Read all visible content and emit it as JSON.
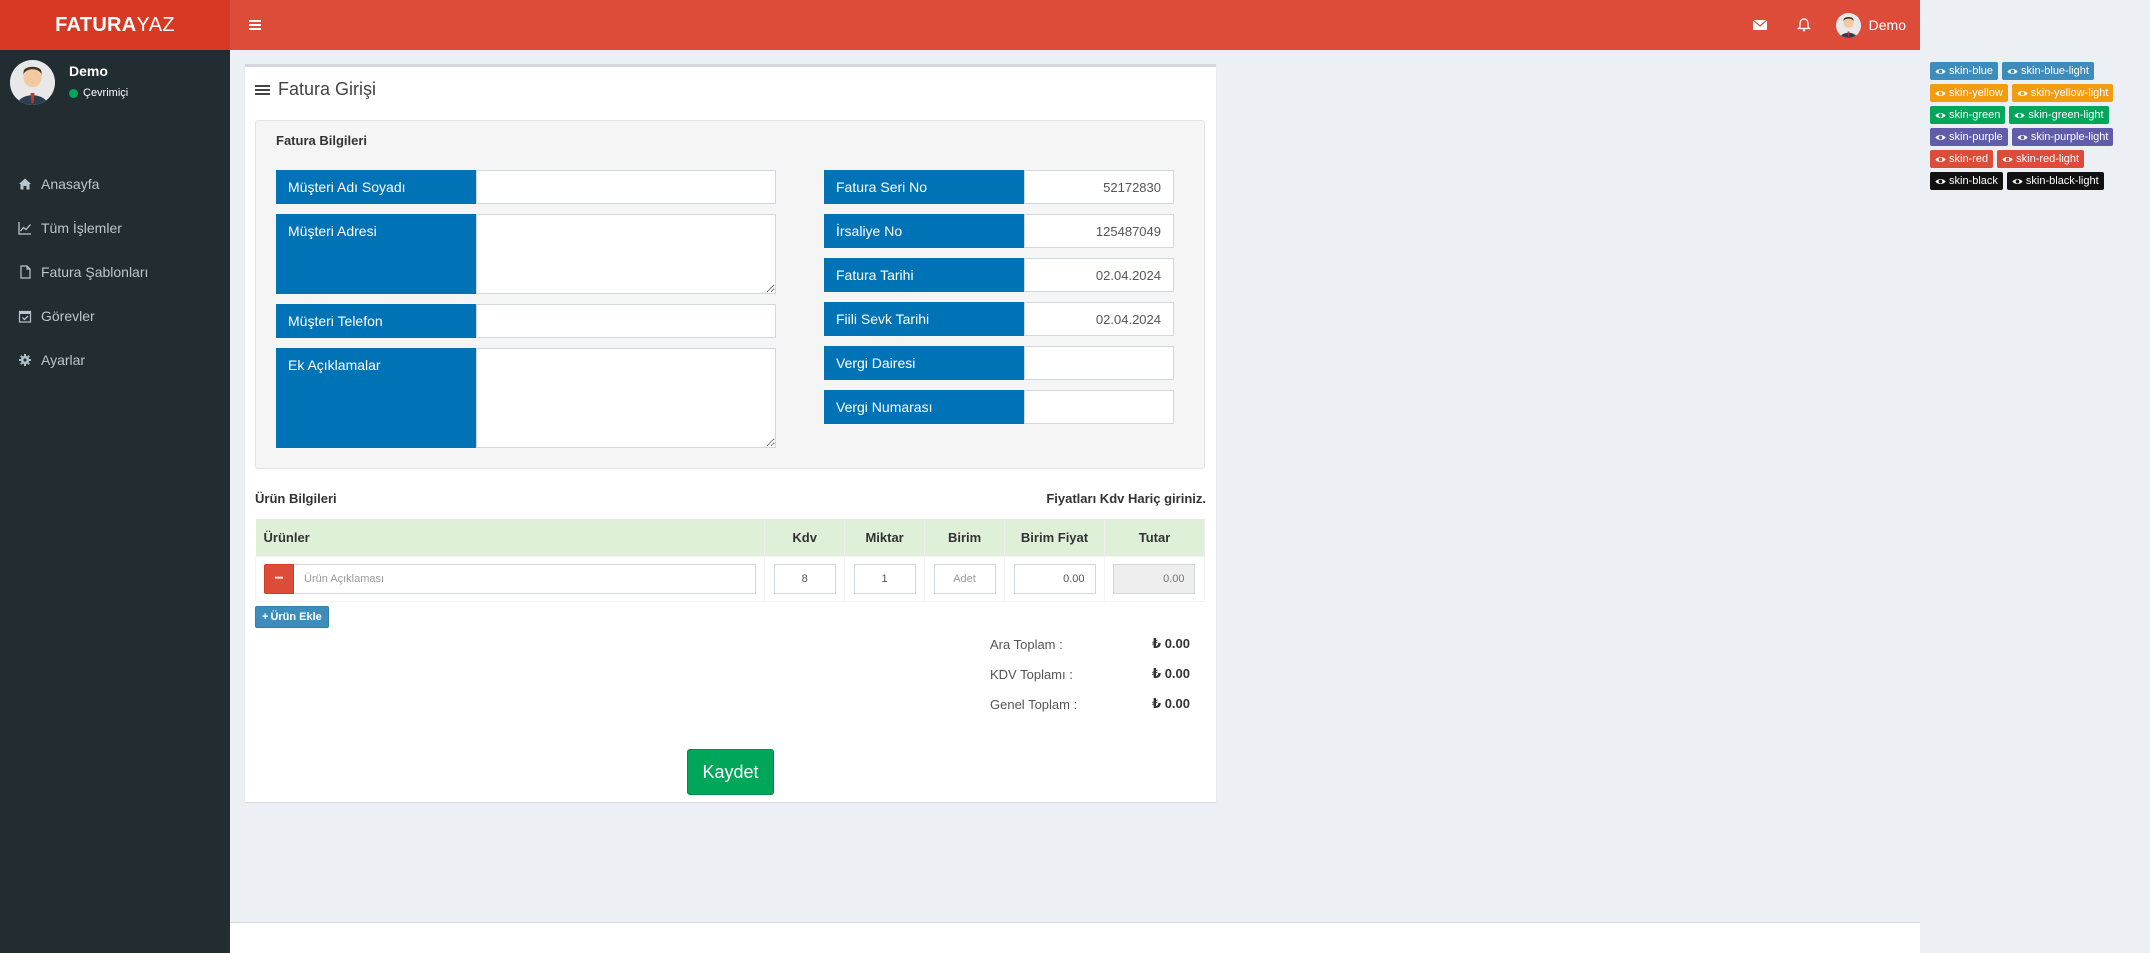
{
  "brand": {
    "bold": "FATURA",
    "light": "YAZ"
  },
  "header": {
    "user_name": "Demo",
    "icons": [
      "bars-icon",
      "envelope-icon",
      "bell-icon"
    ]
  },
  "sidebar": {
    "user_name": "Demo",
    "status": "Çevrimiçi",
    "items": [
      {
        "label": "Anasayfa",
        "icon": "home-icon"
      },
      {
        "label": "Tüm İşlemler",
        "icon": "chart-line-icon"
      },
      {
        "label": "Fatura Şablonları",
        "icon": "file-icon"
      },
      {
        "label": "Görevler",
        "icon": "calendar-check-icon"
      },
      {
        "label": "Ayarlar",
        "icon": "gear-icon"
      }
    ]
  },
  "page": {
    "title": "Fatura Girişi"
  },
  "invoice": {
    "section_title": "Fatura Bilgileri",
    "left": {
      "customer_name": {
        "label": "Müşteri Adı Soyadı",
        "value": ""
      },
      "customer_address": {
        "label": "Müşteri Adresi",
        "value": ""
      },
      "customer_phone": {
        "label": "Müşteri Telefon",
        "value": ""
      },
      "notes": {
        "label": "Ek Açıklamalar",
        "value": ""
      }
    },
    "right": {
      "serial_no": {
        "label": "Fatura Seri No",
        "value": "52172830"
      },
      "waybill_no": {
        "label": "İrsaliye No",
        "value": "125487049"
      },
      "invoice_date": {
        "label": "Fatura Tarihi",
        "value": "02.04.2024"
      },
      "ship_date": {
        "label": "Fiili Sevk Tarihi",
        "value": "02.04.2024"
      },
      "tax_office": {
        "label": "Vergi Dairesi",
        "value": ""
      },
      "tax_number": {
        "label": "Vergi Numarası",
        "value": ""
      }
    }
  },
  "products": {
    "title": "Ürün Bilgileri",
    "note": "Fiyatları Kdv Hariç giriniz.",
    "columns": [
      "Ürünler",
      "Kdv",
      "Miktar",
      "Birim",
      "Birim Fiyat",
      "Tutar"
    ],
    "row": {
      "description_placeholder": "Ürün Açıklaması",
      "kdv": "8",
      "quantity": "1",
      "unit": "Adet",
      "unit_price": "0.00",
      "amount": "0.00"
    },
    "add_label": "Ürün Ekle"
  },
  "totals": {
    "subtotal_label": "Ara Toplam :",
    "subtotal": "₺ 0.00",
    "kdv_label": "KDV Toplamı :",
    "kdv": "₺ 0.00",
    "grand_label": "Genel Toplam :",
    "grand": "₺ 0.00"
  },
  "save_label": "Kaydet",
  "skins": [
    {
      "label": "skin-blue",
      "color": "#3c8dbc"
    },
    {
      "label": "skin-blue-light",
      "color": "#3c8dbc"
    },
    {
      "label": "skin-yellow",
      "color": "#f39c12"
    },
    {
      "label": "skin-yellow-light",
      "color": "#f39c12"
    },
    {
      "label": "skin-green",
      "color": "#00a65a"
    },
    {
      "label": "skin-green-light",
      "color": "#00a65a"
    },
    {
      "label": "skin-purple",
      "color": "#605ca8"
    },
    {
      "label": "skin-purple-light",
      "color": "#605ca8"
    },
    {
      "label": "skin-red",
      "color": "#dd4b39"
    },
    {
      "label": "skin-red-light",
      "color": "#dd4b39"
    },
    {
      "label": "skin-black",
      "color": "#111111"
    },
    {
      "label": "skin-black-light",
      "color": "#111111"
    }
  ],
  "colors": {
    "header": "#dd4b39",
    "logo": "#d73925",
    "sidebar": "#222d32",
    "label_blue": "#0073b7",
    "success": "#00a65a"
  }
}
